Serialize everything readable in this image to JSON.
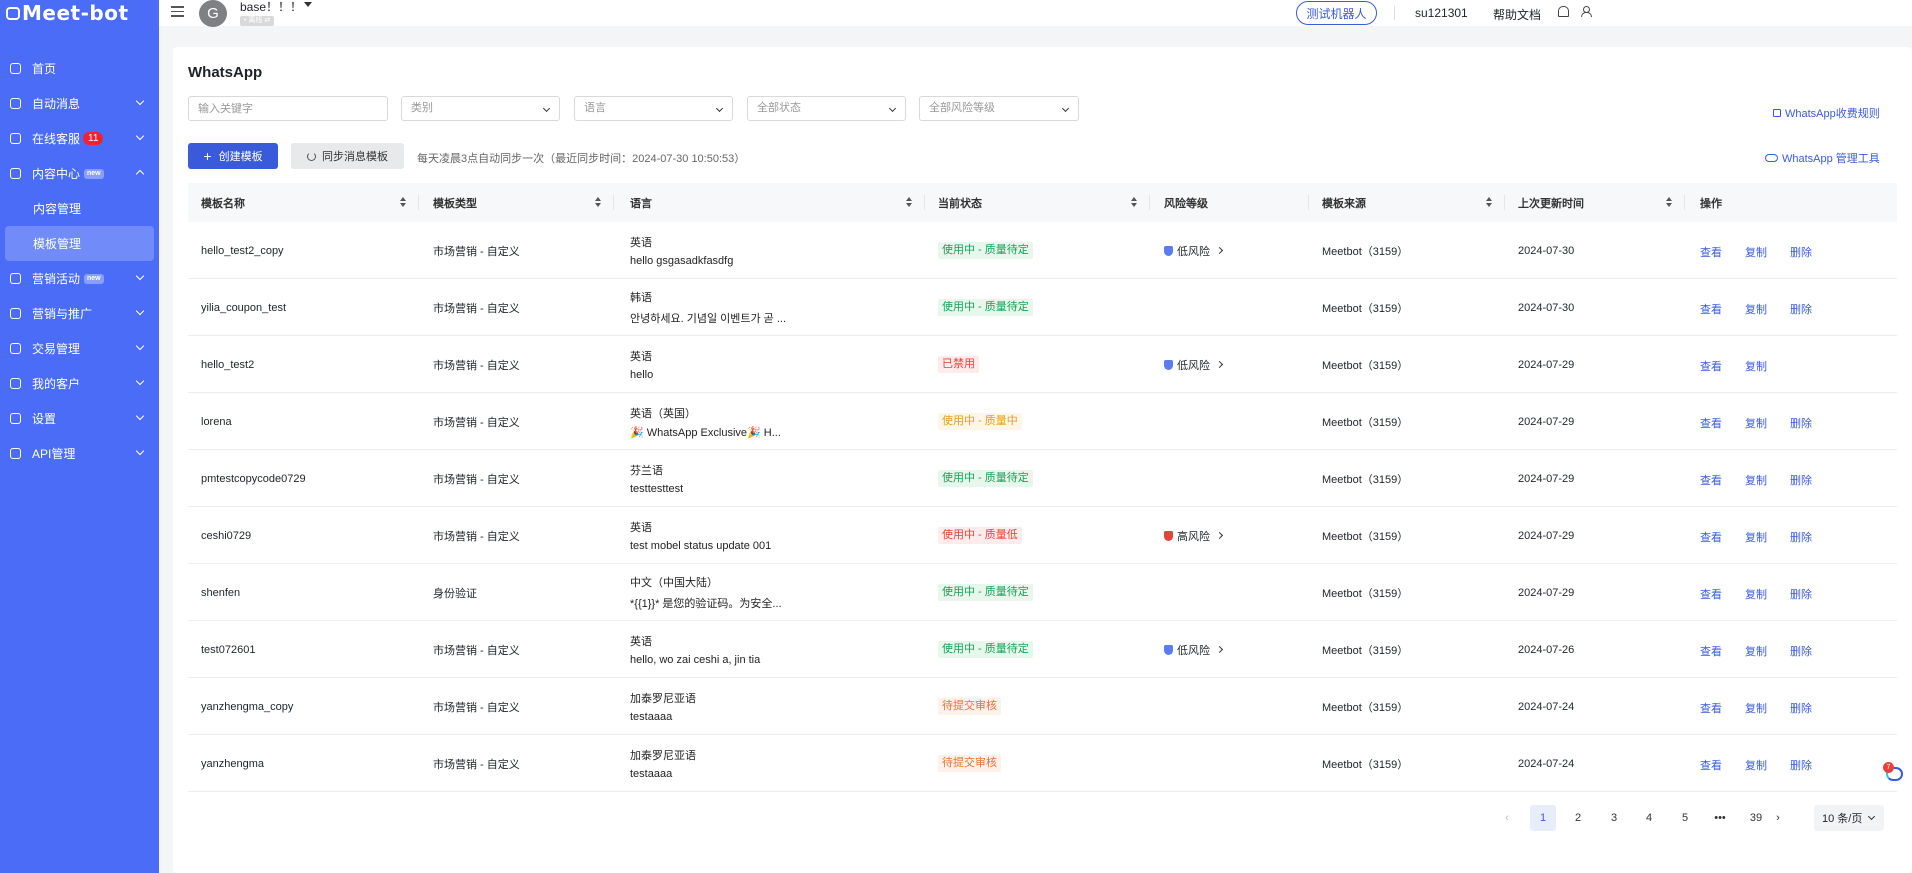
{
  "brand": {
    "logo_text": "Meet-bot"
  },
  "sidebar": {
    "items": [
      {
        "label": "首页"
      },
      {
        "label": "自动消息"
      },
      {
        "label": "在线客服",
        "badge": "11"
      },
      {
        "label": "内容中心",
        "tag": "new"
      },
      {
        "label": "内容管理"
      },
      {
        "label": "模板管理"
      },
      {
        "label": "营销活动",
        "tag": "new"
      },
      {
        "label": "营销与推广"
      },
      {
        "label": "交易管理"
      },
      {
        "label": "我的客户"
      },
      {
        "label": "设置"
      },
      {
        "label": "API管理"
      }
    ]
  },
  "header": {
    "avatar_letter": "G",
    "account_name": "base！！！",
    "account_status": "• 离线 ⇄",
    "test_bot_label": "测试机器人",
    "username": "su121301",
    "help_label": "帮助文档"
  },
  "page": {
    "title": "WhatsApp",
    "filters": {
      "keyword_placeholder": "输入关键字",
      "category": "类别",
      "language": "语言",
      "status": "全部状态",
      "risk": "全部风险等级"
    },
    "pricing_link": "WhatsApp收费规则",
    "create_button": "创建模板",
    "sync_button": "同步消息模板",
    "sync_note": "每天凌晨3点自动同步一次（最近同步时间：2024-07-30 10:50:53）",
    "manager_link": "WhatsApp 管理工具"
  },
  "table": {
    "columns": {
      "name": "模板名称",
      "type": "模板类型",
      "language": "语言",
      "status": "当前状态",
      "risk": "风险等级",
      "source": "模板来源",
      "updated": "上次更新时间",
      "actions": "操作"
    },
    "action_labels": {
      "view": "查看",
      "copy": "复制",
      "delete": "删除"
    },
    "rows": [
      {
        "name": "hello_test2_copy",
        "type": "市场营销 - 自定义",
        "lang": "英语",
        "preview": "hello gsgasadkfasdfg",
        "status": "使用中 - 质量待定",
        "status_color": "green",
        "risk": "低风险",
        "risk_level": "low",
        "source": "Meetbot（3159）",
        "updated": "2024-07-30",
        "can_delete": true
      },
      {
        "name": "yilia_coupon_test",
        "type": "市场营销 - 自定义",
        "lang": "韩语",
        "preview": "안녕하세요. 기념일 이벤트가 곧 ...",
        "status": "使用中 - 质量待定",
        "status_color": "green",
        "risk": "",
        "risk_level": "",
        "source": "Meetbot（3159）",
        "updated": "2024-07-30",
        "can_delete": true
      },
      {
        "name": "hello_test2",
        "type": "市场营销 - 自定义",
        "lang": "英语",
        "preview": "hello",
        "status": "已禁用",
        "status_color": "red",
        "risk": "低风险",
        "risk_level": "low",
        "source": "Meetbot（3159）",
        "updated": "2024-07-29",
        "can_delete": false
      },
      {
        "name": "lorena",
        "type": "市场营销 - 自定义",
        "lang": "英语（英国）",
        "preview": "🎉 WhatsApp Exclusive🎉 H...",
        "status": "使用中 - 质量中",
        "status_color": "amber",
        "risk": "",
        "risk_level": "",
        "source": "Meetbot（3159）",
        "updated": "2024-07-29",
        "can_delete": true
      },
      {
        "name": "pmtestcopycode0729",
        "type": "市场营销 - 自定义",
        "lang": "芬兰语",
        "preview": "testtesttest",
        "status": "使用中 - 质量待定",
        "status_color": "green",
        "risk": "",
        "risk_level": "",
        "source": "Meetbot（3159）",
        "updated": "2024-07-29",
        "can_delete": true
      },
      {
        "name": "ceshi0729",
        "type": "市场营销 - 自定义",
        "lang": "英语",
        "preview": "test mobel status update 001",
        "status": "使用中 - 质量低",
        "status_color": "red",
        "risk": "高风险",
        "risk_level": "high",
        "source": "Meetbot（3159）",
        "updated": "2024-07-29",
        "can_delete": true
      },
      {
        "name": "shenfen",
        "type": "身份验证",
        "lang": "中文（中国大陆）",
        "preview": "*{{1}}* 是您的验证码。为安全...",
        "status": "使用中 - 质量待定",
        "status_color": "green",
        "risk": "",
        "risk_level": "",
        "source": "Meetbot（3159）",
        "updated": "2024-07-29",
        "can_delete": true
      },
      {
        "name": "test072601",
        "type": "市场营销 - 自定义",
        "lang": "英语",
        "preview": "hello, wo zai ceshi a, jin tia",
        "status": "使用中 - 质量待定",
        "status_color": "green",
        "risk": "低风险",
        "risk_level": "low",
        "source": "Meetbot（3159）",
        "updated": "2024-07-26",
        "can_delete": true
      },
      {
        "name": "yanzhengma_copy",
        "type": "市场营销 - 自定义",
        "lang": "加泰罗尼亚语",
        "preview": "testaaaa",
        "status": "待提交审核",
        "status_color": "orange",
        "risk": "",
        "risk_level": "",
        "source": "Meetbot（3159）",
        "updated": "2024-07-24",
        "can_delete": true
      },
      {
        "name": "yanzhengma",
        "type": "市场营销 - 自定义",
        "lang": "加泰罗尼亚语",
        "preview": "testaaaa",
        "status": "待提交审核",
        "status_color": "orange",
        "risk": "",
        "risk_level": "",
        "source": "Meetbot（3159）",
        "updated": "2024-07-24",
        "can_delete": true
      }
    ]
  },
  "pagination": {
    "pages": [
      "1",
      "2",
      "3",
      "4",
      "5",
      "•••",
      "39"
    ],
    "current": "1",
    "page_size": "10 条/页"
  },
  "float_widget": {
    "count": "7"
  },
  "colors": {
    "primary": "#3a5bd9",
    "sidebar": "#4a6cf7"
  }
}
